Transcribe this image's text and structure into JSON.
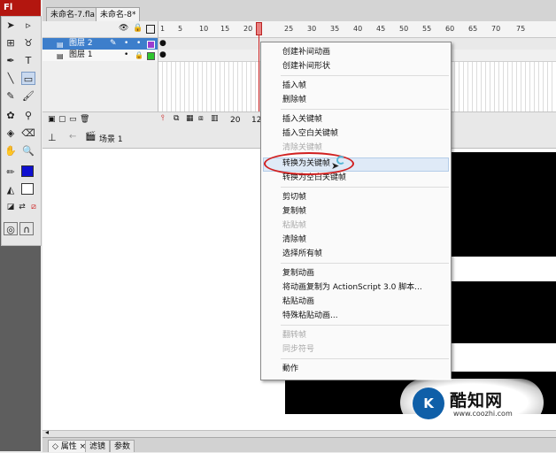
{
  "app": {
    "logo": "Fl"
  },
  "document_tabs": [
    {
      "label": "未命名-7.fla"
    },
    {
      "label": "未命名-8*"
    }
  ],
  "timeline": {
    "layers": [
      {
        "name": "图层 2",
        "selected": true
      },
      {
        "name": "图层 1",
        "selected": false
      }
    ],
    "ruler_ticks": [
      "1",
      "5",
      "10",
      "15",
      "20",
      "25",
      "30",
      "35",
      "40",
      "45",
      "50",
      "55",
      "60",
      "65",
      "70",
      "75"
    ],
    "footer": {
      "current_frame": "20",
      "frame_rate": "12"
    }
  },
  "edit_bar": {
    "scene": "场景 1"
  },
  "context_menu": {
    "groups": [
      [
        {
          "label": "创建补间动画",
          "enabled": true
        },
        {
          "label": "创建补间形状",
          "enabled": true
        }
      ],
      [
        {
          "label": "插入帧",
          "enabled": true
        },
        {
          "label": "删除帧",
          "enabled": true
        }
      ],
      [
        {
          "label": "插入关键帧",
          "enabled": true
        },
        {
          "label": "插入空白关键帧",
          "enabled": true
        },
        {
          "label": "清除关键帧",
          "enabled": false
        },
        {
          "label": "转换为关键帧",
          "enabled": true,
          "highlighted": true
        },
        {
          "label": "转换为空白关键帧",
          "enabled": true
        }
      ],
      [
        {
          "label": "剪切帧",
          "enabled": true
        },
        {
          "label": "复制帧",
          "enabled": true
        },
        {
          "label": "粘贴帧",
          "enabled": false
        },
        {
          "label": "清除帧",
          "enabled": true
        },
        {
          "label": "选择所有帧",
          "enabled": true
        }
      ],
      [
        {
          "label": "复制动画",
          "enabled": true
        },
        {
          "label": "将动画复制为 ActionScript 3.0 脚本...",
          "enabled": true
        },
        {
          "label": "粘贴动画",
          "enabled": true
        },
        {
          "label": "特殊粘贴动画...",
          "enabled": true
        }
      ],
      [
        {
          "label": "翻转帧",
          "enabled": false
        },
        {
          "label": "同步符号",
          "enabled": false
        }
      ],
      [
        {
          "label": "動作",
          "enabled": true
        }
      ]
    ]
  },
  "properties_tabs": [
    {
      "label": "属性"
    },
    {
      "label": "滤镜"
    },
    {
      "label": "参数"
    }
  ],
  "watermark": {
    "logo": "K",
    "name": "酷知网",
    "url": "www.coozhi.com"
  },
  "colors": {
    "selection": "#3d7ecb",
    "menu_highlight": "#dfeaf7",
    "annotation_ring": "#d12020",
    "playhead": "#cc2222",
    "brand": "#b3160f"
  }
}
